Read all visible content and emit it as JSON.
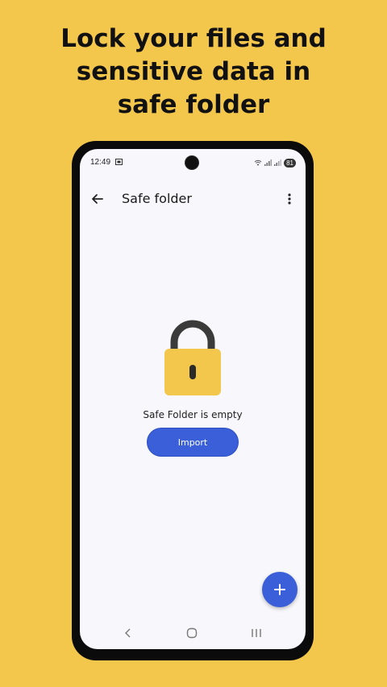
{
  "headline": {
    "line1": "Lock your files and",
    "line2": "sensitive data in",
    "line3": "safe folder"
  },
  "status_bar": {
    "time": "12:49",
    "battery": "81"
  },
  "app_bar": {
    "title": "Safe folder"
  },
  "empty_state": {
    "message": "Safe Folder is empty",
    "import_label": "Import"
  },
  "colors": {
    "background": "#F3C64C",
    "accent": "#3A5FD9",
    "lock_body": "#F3C64C",
    "lock_shackle": "#3B3B3B"
  },
  "icons": [
    "back-arrow-icon",
    "more-vert-icon",
    "lock-icon",
    "plus-icon",
    "nav-back-icon",
    "nav-home-icon",
    "nav-recents-icon"
  ]
}
